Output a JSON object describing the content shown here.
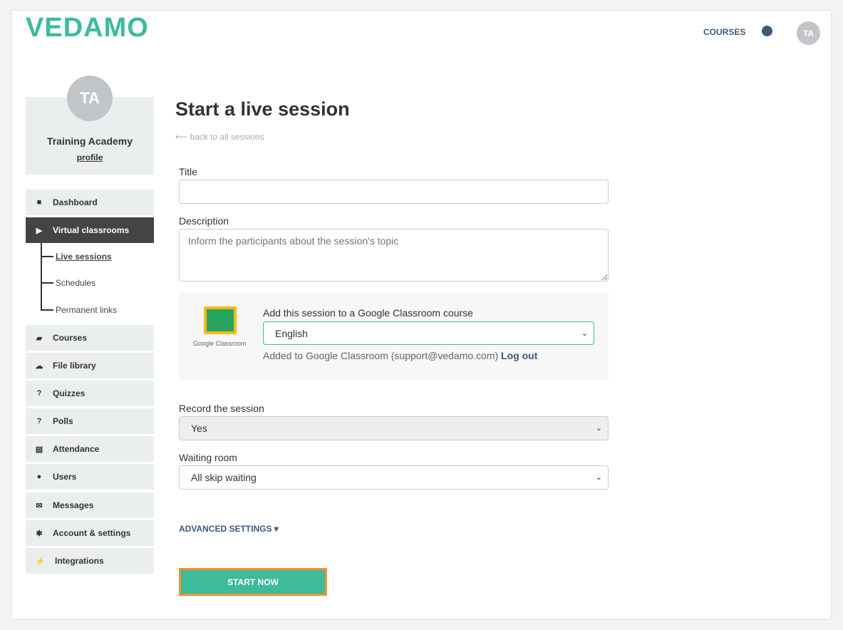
{
  "header": {
    "logo": "VEDAMO",
    "nav_courses": "COURSES",
    "avatar": "TA"
  },
  "profile": {
    "avatar": "TA",
    "name": "Training Academy",
    "link": "profile"
  },
  "sidebar": {
    "items": [
      {
        "label": "Dashboard",
        "icon": "dashboard-icon"
      },
      {
        "label": "Virtual classrooms",
        "icon": "play-circle-icon",
        "active": true
      },
      {
        "label": "Courses",
        "icon": "book-icon"
      },
      {
        "label": "File library",
        "icon": "cloud-upload-icon"
      },
      {
        "label": "Quizzes",
        "icon": "question-circle-icon"
      },
      {
        "label": "Polls",
        "icon": "question-circle-icon"
      },
      {
        "label": "Attendance",
        "icon": "document-icon"
      },
      {
        "label": "Users",
        "icon": "users-icon"
      },
      {
        "label": "Messages",
        "icon": "envelope-icon"
      },
      {
        "label": "Account & settings",
        "icon": "gear-icon"
      },
      {
        "label": "Integrations",
        "icon": "plug-icon"
      }
    ],
    "sub_items": [
      {
        "label": "Live sessions",
        "active": true
      },
      {
        "label": "Schedules"
      },
      {
        "label": "Permanent links"
      }
    ]
  },
  "main": {
    "title": "Start a live session",
    "back_link": "⟵ back to all sessions",
    "title_label": "Title",
    "title_value": "",
    "description_label": "Description",
    "description_placeholder": "Inform the participants about the session's topic",
    "gc": {
      "logo_text": "Google Classroom",
      "label": "Add this session to a Google Classroom course",
      "selected": "English",
      "status": "Added to Google Classroom (support@vedamo.com)",
      "logout": "Log out"
    },
    "record_label": "Record the session",
    "record_value": "Yes",
    "waiting_label": "Waiting room",
    "waiting_value": "All skip waiting",
    "advanced": "ADVANCED SETTINGS ▾",
    "start": "START NOW"
  },
  "colors": {
    "accent": "#3dbb9c",
    "highlight": "#f7902f",
    "link": "#3d5a7a",
    "active_nav": "#444444"
  }
}
